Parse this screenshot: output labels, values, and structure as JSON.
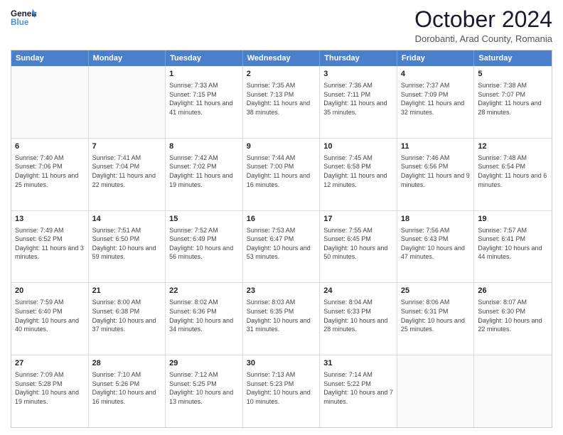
{
  "header": {
    "logo_line1": "General",
    "logo_line2": "Blue",
    "month": "October 2024",
    "location": "Dorobanti, Arad County, Romania"
  },
  "days": [
    "Sunday",
    "Monday",
    "Tuesday",
    "Wednesday",
    "Thursday",
    "Friday",
    "Saturday"
  ],
  "weeks": [
    [
      {
        "day": "",
        "info": ""
      },
      {
        "day": "",
        "info": ""
      },
      {
        "day": "1",
        "info": "Sunrise: 7:33 AM\nSunset: 7:15 PM\nDaylight: 11 hours and 41 minutes."
      },
      {
        "day": "2",
        "info": "Sunrise: 7:35 AM\nSunset: 7:13 PM\nDaylight: 11 hours and 38 minutes."
      },
      {
        "day": "3",
        "info": "Sunrise: 7:36 AM\nSunset: 7:11 PM\nDaylight: 11 hours and 35 minutes."
      },
      {
        "day": "4",
        "info": "Sunrise: 7:37 AM\nSunset: 7:09 PM\nDaylight: 11 hours and 32 minutes."
      },
      {
        "day": "5",
        "info": "Sunrise: 7:38 AM\nSunset: 7:07 PM\nDaylight: 11 hours and 28 minutes."
      }
    ],
    [
      {
        "day": "6",
        "info": "Sunrise: 7:40 AM\nSunset: 7:06 PM\nDaylight: 11 hours and 25 minutes."
      },
      {
        "day": "7",
        "info": "Sunrise: 7:41 AM\nSunset: 7:04 PM\nDaylight: 11 hours and 22 minutes."
      },
      {
        "day": "8",
        "info": "Sunrise: 7:42 AM\nSunset: 7:02 PM\nDaylight: 11 hours and 19 minutes."
      },
      {
        "day": "9",
        "info": "Sunrise: 7:44 AM\nSunset: 7:00 PM\nDaylight: 11 hours and 16 minutes."
      },
      {
        "day": "10",
        "info": "Sunrise: 7:45 AM\nSunset: 6:58 PM\nDaylight: 11 hours and 12 minutes."
      },
      {
        "day": "11",
        "info": "Sunrise: 7:46 AM\nSunset: 6:56 PM\nDaylight: 11 hours and 9 minutes."
      },
      {
        "day": "12",
        "info": "Sunrise: 7:48 AM\nSunset: 6:54 PM\nDaylight: 11 hours and 6 minutes."
      }
    ],
    [
      {
        "day": "13",
        "info": "Sunrise: 7:49 AM\nSunset: 6:52 PM\nDaylight: 11 hours and 3 minutes."
      },
      {
        "day": "14",
        "info": "Sunrise: 7:51 AM\nSunset: 6:50 PM\nDaylight: 10 hours and 59 minutes."
      },
      {
        "day": "15",
        "info": "Sunrise: 7:52 AM\nSunset: 6:49 PM\nDaylight: 10 hours and 56 minutes."
      },
      {
        "day": "16",
        "info": "Sunrise: 7:53 AM\nSunset: 6:47 PM\nDaylight: 10 hours and 53 minutes."
      },
      {
        "day": "17",
        "info": "Sunrise: 7:55 AM\nSunset: 6:45 PM\nDaylight: 10 hours and 50 minutes."
      },
      {
        "day": "18",
        "info": "Sunrise: 7:56 AM\nSunset: 6:43 PM\nDaylight: 10 hours and 47 minutes."
      },
      {
        "day": "19",
        "info": "Sunrise: 7:57 AM\nSunset: 6:41 PM\nDaylight: 10 hours and 44 minutes."
      }
    ],
    [
      {
        "day": "20",
        "info": "Sunrise: 7:59 AM\nSunset: 6:40 PM\nDaylight: 10 hours and 40 minutes."
      },
      {
        "day": "21",
        "info": "Sunrise: 8:00 AM\nSunset: 6:38 PM\nDaylight: 10 hours and 37 minutes."
      },
      {
        "day": "22",
        "info": "Sunrise: 8:02 AM\nSunset: 6:36 PM\nDaylight: 10 hours and 34 minutes."
      },
      {
        "day": "23",
        "info": "Sunrise: 8:03 AM\nSunset: 6:35 PM\nDaylight: 10 hours and 31 minutes."
      },
      {
        "day": "24",
        "info": "Sunrise: 8:04 AM\nSunset: 6:33 PM\nDaylight: 10 hours and 28 minutes."
      },
      {
        "day": "25",
        "info": "Sunrise: 8:06 AM\nSunset: 6:31 PM\nDaylight: 10 hours and 25 minutes."
      },
      {
        "day": "26",
        "info": "Sunrise: 8:07 AM\nSunset: 6:30 PM\nDaylight: 10 hours and 22 minutes."
      }
    ],
    [
      {
        "day": "27",
        "info": "Sunrise: 7:09 AM\nSunset: 5:28 PM\nDaylight: 10 hours and 19 minutes."
      },
      {
        "day": "28",
        "info": "Sunrise: 7:10 AM\nSunset: 5:26 PM\nDaylight: 10 hours and 16 minutes."
      },
      {
        "day": "29",
        "info": "Sunrise: 7:12 AM\nSunset: 5:25 PM\nDaylight: 10 hours and 13 minutes."
      },
      {
        "day": "30",
        "info": "Sunrise: 7:13 AM\nSunset: 5:23 PM\nDaylight: 10 hours and 10 minutes."
      },
      {
        "day": "31",
        "info": "Sunrise: 7:14 AM\nSunset: 5:22 PM\nDaylight: 10 hours and 7 minutes."
      },
      {
        "day": "",
        "info": ""
      },
      {
        "day": "",
        "info": ""
      }
    ]
  ]
}
